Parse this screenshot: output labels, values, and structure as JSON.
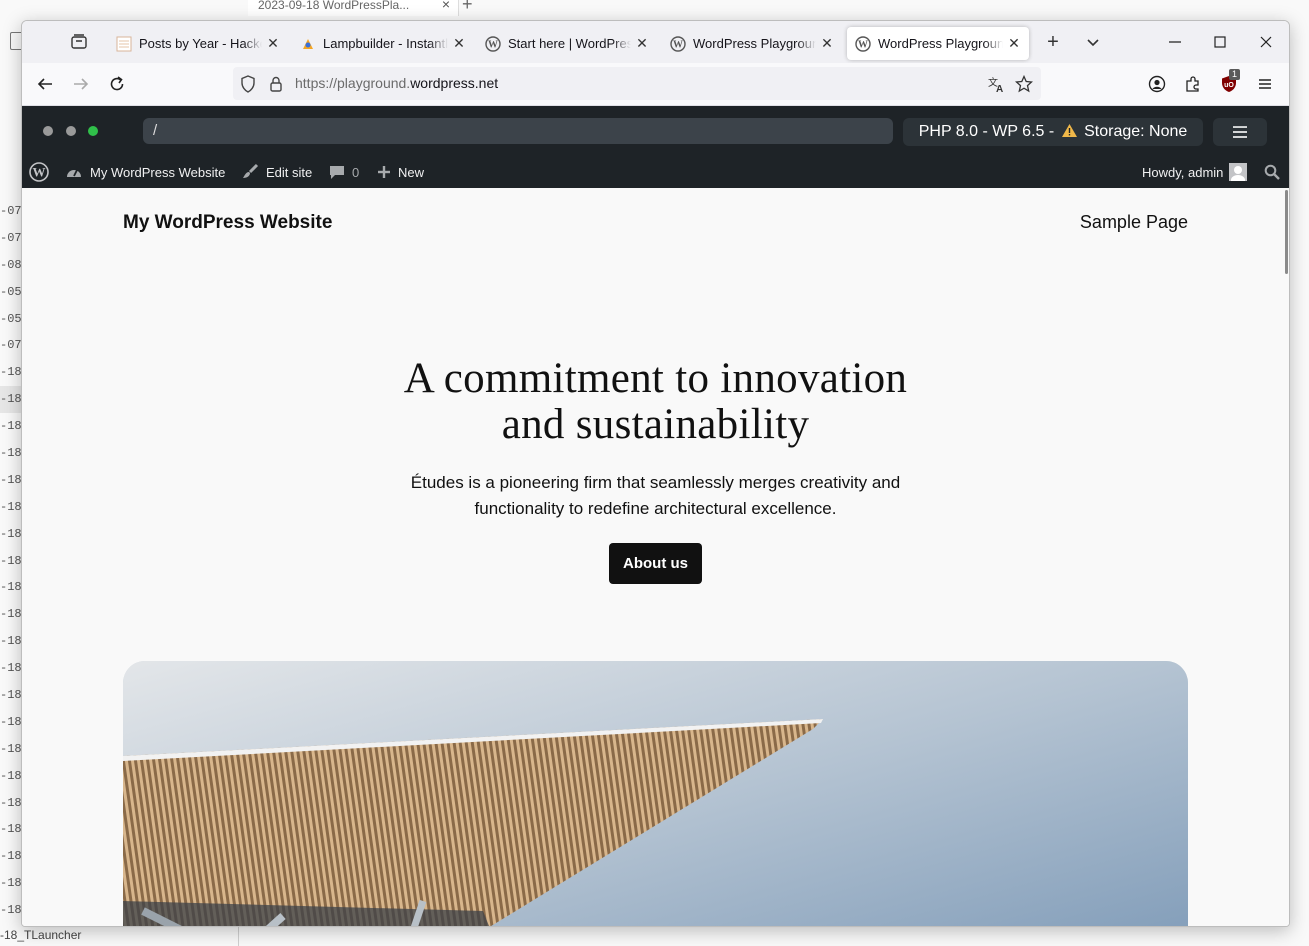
{
  "background": {
    "tab_title": "2023-09-18 WordPressPla...",
    "list_items": [
      "-07",
      "-07",
      "-08",
      "-05",
      "-05",
      "-07",
      "-18",
      "-18",
      "-18",
      "-18",
      "-18",
      "-18",
      "-18",
      "-18",
      "-18",
      "-18",
      "-18",
      "-18",
      "-18",
      "-18",
      "-18",
      "-18",
      "-18",
      "-18",
      "-18",
      "-18",
      "-18"
    ],
    "launcher_label": "-18_TLauncher"
  },
  "tabs": [
    {
      "title": "Posts by Year - HackerN",
      "favicon": "hackernews-icon"
    },
    {
      "title": "Lampbuilder - Instantly",
      "favicon": "lampbuilder-icon"
    },
    {
      "title": "Start here | WordPress Pl",
      "favicon": "wordpress-icon"
    },
    {
      "title": "WordPress Playground",
      "favicon": "wordpress-icon"
    },
    {
      "title": "WordPress Playground",
      "favicon": "wordpress-icon",
      "active": true
    }
  ],
  "address_bar": {
    "url_prefix": "https://playground.",
    "url_domain": "wordpress.net"
  },
  "extension_badge": "1",
  "playground": {
    "path": "/",
    "env_text": "PHP 8.0 - WP 6.5 -",
    "storage_text": "Storage: None"
  },
  "admin_bar": {
    "site_name": "My WordPress Website",
    "edit_site": "Edit site",
    "comments_count": "0",
    "new_label": "New",
    "howdy": "Howdy, admin"
  },
  "site": {
    "title": "My WordPress Website",
    "nav_item": "Sample Page",
    "hero_heading_line1": "A commitment to innovation",
    "hero_heading_line2": "and sustainability",
    "hero_text_line1": "Études is a pioneering firm that seamlessly merges creativity and",
    "hero_text_line2": "functionality to redefine architectural excellence.",
    "cta_label": "About us"
  },
  "colors": {
    "admin_bar_bg": "#1e2327",
    "dot_gray": "#9a9a9a",
    "dot_green": "#30c04a",
    "warning": "#f0b849",
    "button_bg": "#111111"
  }
}
